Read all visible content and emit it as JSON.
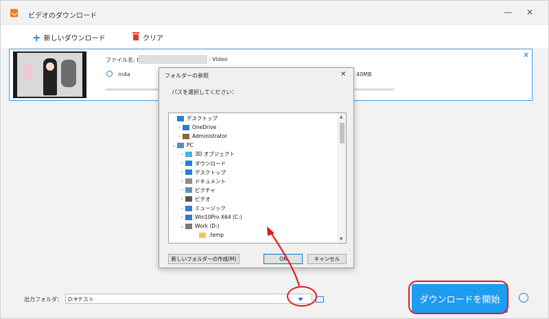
{
  "window": {
    "title": "ビデオのダウンロード",
    "minimize": "—",
    "close": "✕"
  },
  "toolbar": {
    "new_download": "新しいダウンロード",
    "clear": "クリア"
  },
  "item": {
    "file_label": "ファイル名: tu",
    "file_suffix": ": Video",
    "format": "m4a",
    "size": "40MB",
    "close": "✕"
  },
  "bottom": {
    "output_label": "出力フォルダ：",
    "output_path": "D:¥テスト",
    "start_button": "ダウンロードを開始"
  },
  "dialog": {
    "title": "フォルダーの参照",
    "close": "✕",
    "prompt": "パスを選択してください：",
    "new_folder_button": "新しいフォルダーの作成(M)",
    "ok_button": "OK",
    "cancel_button": "キャンセル",
    "tree": [
      {
        "label": "デスクトップ",
        "icon": "desktop-icon",
        "color": "#2a7fd4"
      },
      {
        "label": "OneDrive",
        "icon": "cloud-icon",
        "color": "#2a7fd4"
      },
      {
        "label": "Administrator",
        "icon": "user-icon",
        "color": "#8a6a3c"
      },
      {
        "label": "PC",
        "icon": "computer-icon",
        "color": "#5a8fbf"
      },
      {
        "label": "3D オブジェクト",
        "icon": "cube-icon",
        "color": "#4ab0e6"
      },
      {
        "label": "ダウンロード",
        "icon": "download-icon",
        "color": "#2a7fd4"
      },
      {
        "label": "デスクトップ",
        "icon": "desktop-icon",
        "color": "#2a7fd4"
      },
      {
        "label": "ドキュメント",
        "icon": "document-icon",
        "color": "#8c8c8c"
      },
      {
        "label": "ピクチャ",
        "icon": "picture-icon",
        "color": "#5a8fbf"
      },
      {
        "label": "ビデオ",
        "icon": "video-icon",
        "color": "#555555"
      },
      {
        "label": "ミュージック",
        "icon": "music-icon",
        "color": "#2a7fd4"
      },
      {
        "label": "Win10Pro X64 (C:)",
        "icon": "drive-icon",
        "color": "#3b77c4"
      },
      {
        "label": "Work (D:)",
        "icon": "drive-icon",
        "color": "#777777"
      },
      {
        "label": ".temp",
        "icon": "folder-icon",
        "color": "#f2c94c"
      }
    ]
  },
  "colors": {
    "accent": "#1e9cf0",
    "annotation": "#e21a1a"
  }
}
